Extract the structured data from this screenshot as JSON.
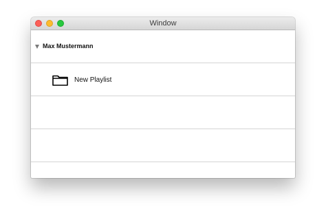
{
  "window": {
    "title": "Window"
  },
  "colors": {
    "close": "#fc5f57",
    "minimize": "#fdbc2e",
    "maximize": "#28c83f",
    "separator": "#d4d4d4"
  },
  "outline": {
    "group": {
      "label": "Max Mustermann",
      "expanded": true,
      "icon": "disclosure-triangle-down-icon"
    },
    "items": [
      {
        "label": "New Playlist",
        "icon": "folder-icon"
      }
    ]
  }
}
